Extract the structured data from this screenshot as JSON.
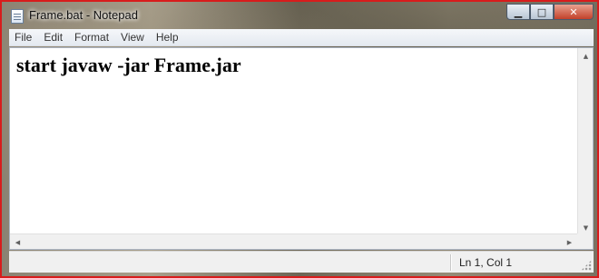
{
  "window": {
    "title": "Frame.bat - Notepad",
    "icon": "notepad-icon",
    "controls": {
      "minimize": "▁",
      "maximize": "□",
      "close": "✕"
    }
  },
  "menubar": {
    "items": [
      {
        "label": "File"
      },
      {
        "label": "Edit"
      },
      {
        "label": "Format"
      },
      {
        "label": "View"
      },
      {
        "label": "Help"
      }
    ]
  },
  "editor": {
    "content": "start javaw -jar Frame.jar"
  },
  "scrollbars": {
    "up": "▲",
    "down": "▼",
    "left": "◀",
    "right": "▶"
  },
  "statusbar": {
    "position": "Ln 1, Col 1"
  },
  "colors": {
    "frame_border": "#d81c1c",
    "close_button": "#c2412a",
    "menubar_bg": "#f5f7fa"
  }
}
